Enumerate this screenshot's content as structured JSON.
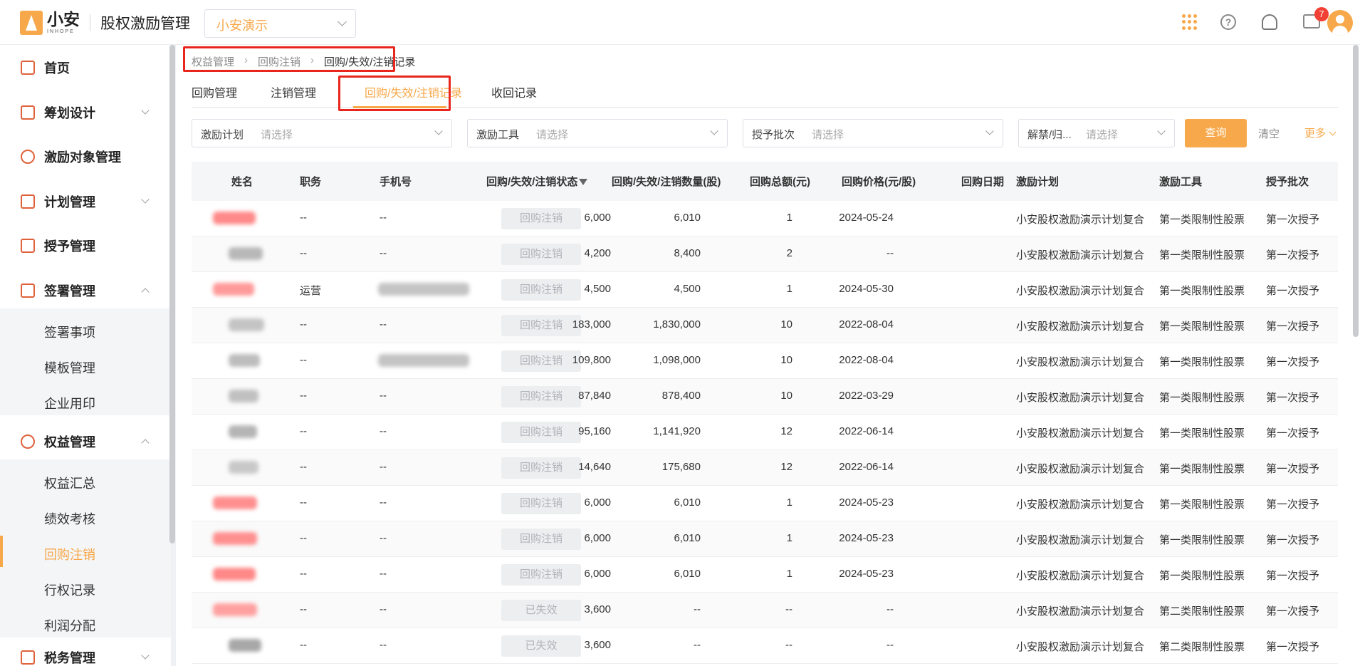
{
  "header": {
    "logo_cn": "小安",
    "logo_en": "INHOPE",
    "app_title": "股权激励管理",
    "company": "小安演示",
    "help_glyph": "?",
    "message_badge": "7"
  },
  "sidebar": {
    "items": [
      {
        "label": "首页",
        "icon": "home-icon"
      },
      {
        "label": "筹划设计",
        "icon": "edit-icon"
      },
      {
        "label": "激励对象管理",
        "icon": "users-icon"
      },
      {
        "label": "计划管理",
        "icon": "apps-icon"
      },
      {
        "label": "授予管理",
        "icon": "book-icon"
      },
      {
        "label": "签署管理",
        "icon": "pen-icon"
      },
      {
        "label": "权益管理",
        "icon": "badge-icon"
      },
      {
        "label": "税务管理",
        "icon": "tax-icon"
      }
    ],
    "sign_sub": [
      "签署事项",
      "模板管理",
      "企业用印"
    ],
    "equity_sub": [
      "权益汇总",
      "绩效考核",
      "回购注销",
      "行权记录",
      "利润分配"
    ]
  },
  "breadcrumb": [
    "权益管理",
    "回购注销",
    "回购/失效/注销记录"
  ],
  "tabs": [
    "回购管理",
    "注销管理",
    "回购/失效/注销记录",
    "收回记录"
  ],
  "filters": {
    "plan_label": "激励计划",
    "tool_label": "激励工具",
    "batch_label": "授予批次",
    "unlock_label": "解禁/归...",
    "placeholder": "请选择",
    "query": "查询",
    "clear": "清空",
    "more": "更多"
  },
  "table": {
    "headers": [
      "姓名",
      "职务",
      "手机号",
      "回购/失效/注销状态",
      "回购/失效/注销数量(股)",
      "回购总额(元)",
      "回购价格(元/股)",
      "回购日期",
      "激励计划",
      "激励工具",
      "授予批次"
    ],
    "rows": [
      {
        "position": "--",
        "phone": "--",
        "status": "回购注销",
        "qty": "6,000",
        "total": "6,010",
        "price": "1",
        "date": "2024-05-24",
        "plan": "小安股权激励演示计划复合",
        "tool": "第一类限制性股票",
        "batch": "第一次授予"
      },
      {
        "position": "--",
        "phone": "--",
        "status": "回购注销",
        "qty": "4,200",
        "total": "8,400",
        "price": "2",
        "date": "--",
        "plan": "小安股权激励演示计划复合",
        "tool": "第一类限制性股票",
        "batch": "第一次授予"
      },
      {
        "position": "运营",
        "phone": "",
        "status": "回购注销",
        "qty": "4,500",
        "total": "4,500",
        "price": "1",
        "date": "2024-05-30",
        "plan": "小安股权激励演示计划复合",
        "tool": "第一类限制性股票",
        "batch": "第一次授予"
      },
      {
        "position": "--",
        "phone": "--",
        "status": "回购注销",
        "qty": "183,000",
        "total": "1,830,000",
        "price": "10",
        "date": "2022-08-04",
        "plan": "小安股权激励演示计划复合",
        "tool": "第一类限制性股票",
        "batch": "第一次授予"
      },
      {
        "position": "--",
        "phone": "",
        "status": "回购注销",
        "qty": "109,800",
        "total": "1,098,000",
        "price": "10",
        "date": "2022-08-04",
        "plan": "小安股权激励演示计划复合",
        "tool": "第一类限制性股票",
        "batch": "第一次授予"
      },
      {
        "position": "--",
        "phone": "--",
        "status": "回购注销",
        "qty": "87,840",
        "total": "878,400",
        "price": "10",
        "date": "2022-03-29",
        "plan": "小安股权激励演示计划复合",
        "tool": "第一类限制性股票",
        "batch": "第一次授予"
      },
      {
        "position": "--",
        "phone": "--",
        "status": "回购注销",
        "qty": "95,160",
        "total": "1,141,920",
        "price": "12",
        "date": "2022-06-14",
        "plan": "小安股权激励演示计划复合",
        "tool": "第一类限制性股票",
        "batch": "第一次授予"
      },
      {
        "position": "--",
        "phone": "--",
        "status": "回购注销",
        "qty": "14,640",
        "total": "175,680",
        "price": "12",
        "date": "2022-06-14",
        "plan": "小安股权激励演示计划复合",
        "tool": "第一类限制性股票",
        "batch": "第一次授予"
      },
      {
        "position": "--",
        "phone": "--",
        "status": "回购注销",
        "qty": "6,000",
        "total": "6,010",
        "price": "1",
        "date": "2024-05-23",
        "plan": "小安股权激励演示计划复合",
        "tool": "第一类限制性股票",
        "batch": "第一次授予"
      },
      {
        "position": "--",
        "phone": "--",
        "status": "回购注销",
        "qty": "6,000",
        "total": "6,010",
        "price": "1",
        "date": "2024-05-23",
        "plan": "小安股权激励演示计划复合",
        "tool": "第一类限制性股票",
        "batch": "第一次授予"
      },
      {
        "position": "--",
        "phone": "--",
        "status": "回购注销",
        "qty": "6,000",
        "total": "6,010",
        "price": "1",
        "date": "2024-05-23",
        "plan": "小安股权激励演示计划复合",
        "tool": "第一类限制性股票",
        "batch": "第一次授予"
      },
      {
        "position": "--",
        "phone": "--",
        "status": "已失效",
        "qty": "3,600",
        "total": "--",
        "price": "--",
        "date": "--",
        "plan": "小安股权激励演示计划复合",
        "tool": "第二类限制性股票",
        "batch": "第一次授予"
      },
      {
        "position": "--",
        "phone": "--",
        "status": "已失效",
        "qty": "3,600",
        "total": "--",
        "price": "--",
        "date": "--",
        "plan": "小安股权激励演示计划复合",
        "tool": "第二类限制性股票",
        "batch": "第一次授予"
      }
    ]
  },
  "colors": {
    "accent": "#f7a84a",
    "highlight_box": "#e8261e",
    "badge": "#f04134"
  }
}
